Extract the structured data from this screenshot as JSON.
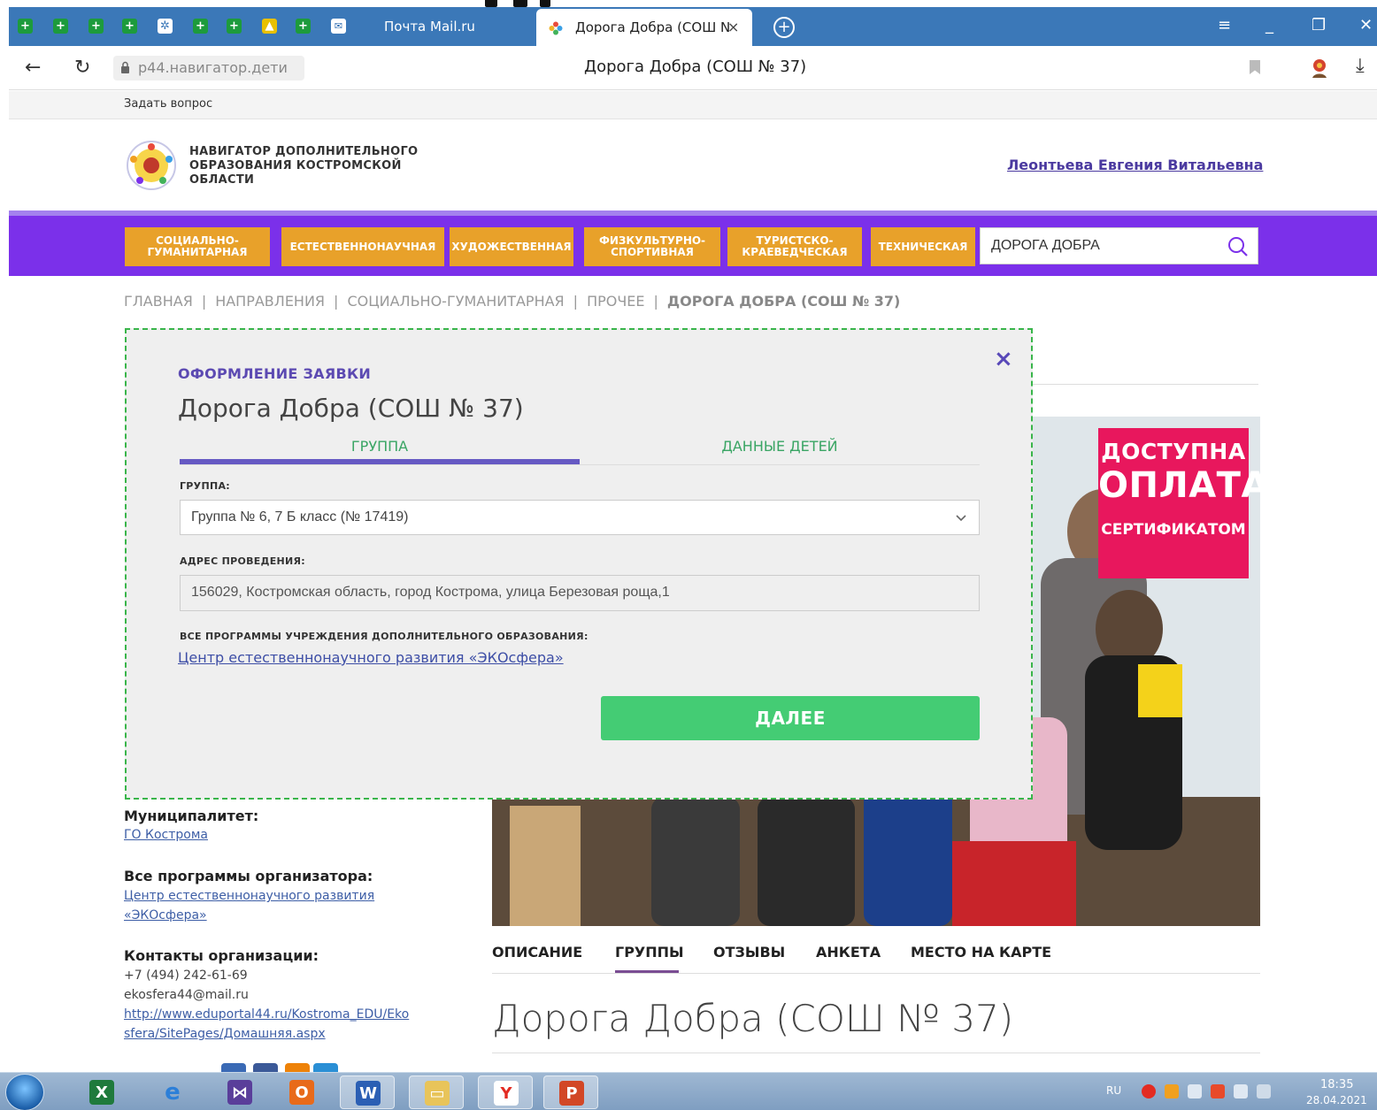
{
  "browser": {
    "tabs": [
      {
        "label": "Почта Mail.ru"
      },
      {
        "label": "Дорога Добра (СОШ N",
        "active": true
      }
    ],
    "tab_close": "×",
    "new_tab": "+",
    "url": "p44.навигатор.дети",
    "page_title": "Дорога Добра (СОШ № 37)"
  },
  "site": {
    "ask_question": "Задать вопрос",
    "logo_text": "НАВИГАТОР ДОПОЛНИТЕЛЬНОГО ОБРАЗОВАНИЯ КОСТРОМСКОЙ ОБЛАСТИ",
    "user_name": "Леонтьева Евгения Витальевна",
    "nav": [
      "СОЦИАЛЬНО-ГУМАНИТАРНАЯ",
      "ЕСТЕСТВЕННОНАУЧНАЯ",
      "ХУДОЖЕСТВЕННАЯ",
      "ФИЗКУЛЬТУРНО-СПОРТИВНАЯ",
      "ТУРИСТСКО-КРАЕВЕДЧЕСКАЯ",
      "ТЕХНИЧЕСКАЯ"
    ],
    "search_value": "ДОРОГА ДОБРА",
    "breadcrumb": [
      "ГЛАВНАЯ",
      "НАПРАВЛЕНИЯ",
      "СОЦИАЛЬНО-ГУМАНИТАРНАЯ",
      "ПРОЧЕЕ",
      "ДОРОГА ДОБРА (СОШ № 37)"
    ],
    "breadcrumb_sep": "|"
  },
  "promo": {
    "line1": "ДОСТУПНА",
    "line2": "ОПЛАТА",
    "line3": "СЕРТИФИКАТОМ"
  },
  "sidebar": {
    "municipality_label": "Муниципалитет:",
    "municipality_value": "ГО Кострома",
    "organizer_label": "Все программы организатора:",
    "organizer_line1": "Центр естественнонаучного развития",
    "organizer_line2": "«ЭКОсфера»",
    "contacts_label": "Контакты организации:",
    "phone": "+7 (494) 242-61-69",
    "email": "ekosfera44@mail.ru",
    "site_line1": "http://www.eduportal44.ru/Kostroma_EDU/Eko",
    "site_line2": "sfera/SitePages/Домашняя.aspx"
  },
  "content": {
    "tabs": [
      "ОПИСАНИЕ",
      "ГРУППЫ",
      "ОТЗЫВЫ",
      "АНКЕТА",
      "МЕСТО НА КАРТЕ"
    ],
    "title": "Дорога Добра (СОШ № 37)"
  },
  "modal": {
    "kicker": "ОФОРМЛЕНИЕ ЗАЯВКИ",
    "title": "Дорога Добра (СОШ № 37)",
    "tabs": [
      "ГРУППА",
      "ДАННЫЕ ДЕТЕЙ"
    ],
    "group_label": "ГРУППА:",
    "group_value": "Группа № 6, 7 Б класс (№ 17419)",
    "address_label": "АДРЕС ПРОВЕДЕНИЯ:",
    "address_value": "156029, Костромская область, город Кострома, улица Березовая роща,1",
    "programs_label": "ВСЕ ПРОГРАММЫ УЧРЕЖДЕНИЯ ДОПОЛНИТЕЛЬНОГО ОБРАЗОВАНИЯ:",
    "programs_link": "Центр естественнонаучного развития «ЭКОсфера»",
    "next_label": "ДАЛЕЕ",
    "close": "×"
  },
  "taskbar": {
    "lang": "RU",
    "time": "18:35",
    "date": "28.04.2021"
  },
  "colors": {
    "nav_purple": "#7b30ea",
    "nav_button": "#e8a12a",
    "next_button": "#44cc74",
    "modal_border": "#39b54a",
    "promo": "#e8175d",
    "tab_bar": "#3b78b8"
  }
}
